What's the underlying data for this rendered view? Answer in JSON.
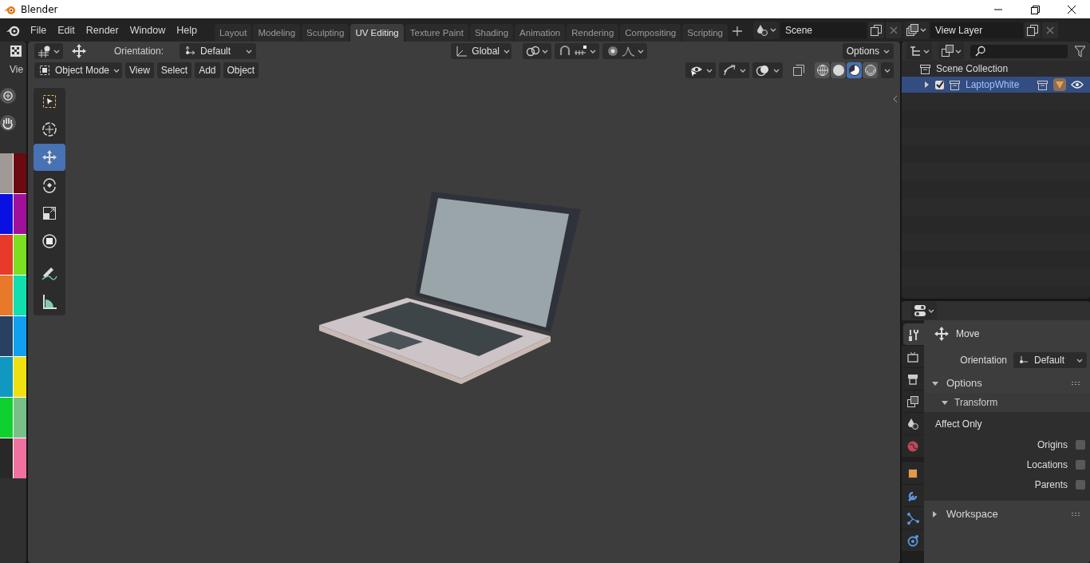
{
  "window": {
    "title": "Blender"
  },
  "menu": [
    "File",
    "Edit",
    "Render",
    "Window",
    "Help"
  ],
  "workspaces": [
    {
      "label": "Layout",
      "selected": false
    },
    {
      "label": "Modeling",
      "selected": false
    },
    {
      "label": "Sculpting",
      "selected": false
    },
    {
      "label": "UV Editing",
      "selected": true
    },
    {
      "label": "Texture Paint",
      "selected": false
    },
    {
      "label": "Shading",
      "selected": false
    },
    {
      "label": "Animation",
      "selected": false
    },
    {
      "label": "Rendering",
      "selected": false
    },
    {
      "label": "Compositing",
      "selected": false
    },
    {
      "label": "Scripting",
      "selected": false
    }
  ],
  "scene": "Scene",
  "view_layer": "View Layer",
  "side_editor": {
    "label": "Vie",
    "palette": [
      {
        "color": "#a09a96"
      },
      {
        "color": "#6b0a10"
      },
      {
        "color": "#0a10e0"
      },
      {
        "color": "#a0109a"
      },
      {
        "color": "#e83a2a"
      },
      {
        "color": "#7ae020"
      },
      {
        "color": "#e8782a"
      },
      {
        "color": "#10e0b0"
      },
      {
        "color": "#2a4060"
      },
      {
        "color": "#10a0f0"
      },
      {
        "color": "#1098c0"
      },
      {
        "color": "#f0e010"
      },
      {
        "color": "#10d030"
      },
      {
        "color": "#78c088"
      },
      {
        "color": "#282828"
      },
      {
        "color": "#f070a0"
      }
    ]
  },
  "viewport": {
    "orientation_label": "Orientation:",
    "orientation": "Default",
    "transform_orientation": "Global",
    "options": "Options",
    "mode": "Object Mode",
    "snap": {
      "on": false
    },
    "proportional_edit": {
      "on": false
    },
    "menus": [
      "View",
      "Select",
      "Add",
      "Object"
    ],
    "shading": [
      {
        "kind": "wireframe",
        "selected": false
      },
      {
        "kind": "solid",
        "selected": false
      },
      {
        "kind": "material",
        "selected": true
      },
      {
        "kind": "rendered",
        "selected": false
      }
    ],
    "tools": [
      {
        "kind": "select",
        "selected": false
      },
      {
        "kind": "cursor",
        "selected": false
      },
      {
        "kind": "move",
        "selected": true
      },
      {
        "kind": "rotate",
        "selected": false
      },
      {
        "kind": "scale",
        "selected": false
      },
      {
        "kind": "transform",
        "selected": false
      },
      {
        "kind": "annotate",
        "selected": false
      },
      {
        "kind": "measure",
        "selected": false
      }
    ]
  },
  "outliner": {
    "items": [
      {
        "label": "Scene Collection",
        "children": [
          {
            "label": "LaptopWhite",
            "expanded": false,
            "checked": true,
            "selected": true
          }
        ]
      }
    ]
  },
  "properties": {
    "tabs": [
      {
        "kind": "tool",
        "selected": true
      },
      {
        "kind": "render",
        "selected": false
      },
      {
        "kind": "output",
        "selected": false
      },
      {
        "kind": "view_layer",
        "selected": false
      },
      {
        "kind": "scene",
        "selected": false
      },
      {
        "kind": "world",
        "selected": false
      },
      {
        "kind": "object",
        "selected": false
      },
      {
        "kind": "modifiers",
        "selected": false
      },
      {
        "kind": "particles",
        "selected": false
      },
      {
        "kind": "physics",
        "selected": false
      }
    ],
    "tool": "Move",
    "orientation_label": "Orientation",
    "orientation": "Default",
    "options": {
      "title": "Options",
      "expanded": true,
      "transform": {
        "title": "Transform",
        "expanded": true,
        "affect_label": "Affect Only",
        "checkboxes": [
          {
            "label": "Origins",
            "checked": false
          },
          {
            "label": "Locations",
            "checked": false
          },
          {
            "label": "Parents",
            "checked": false
          }
        ]
      }
    },
    "workspace": {
      "title": "Workspace",
      "expanded": false
    }
  }
}
